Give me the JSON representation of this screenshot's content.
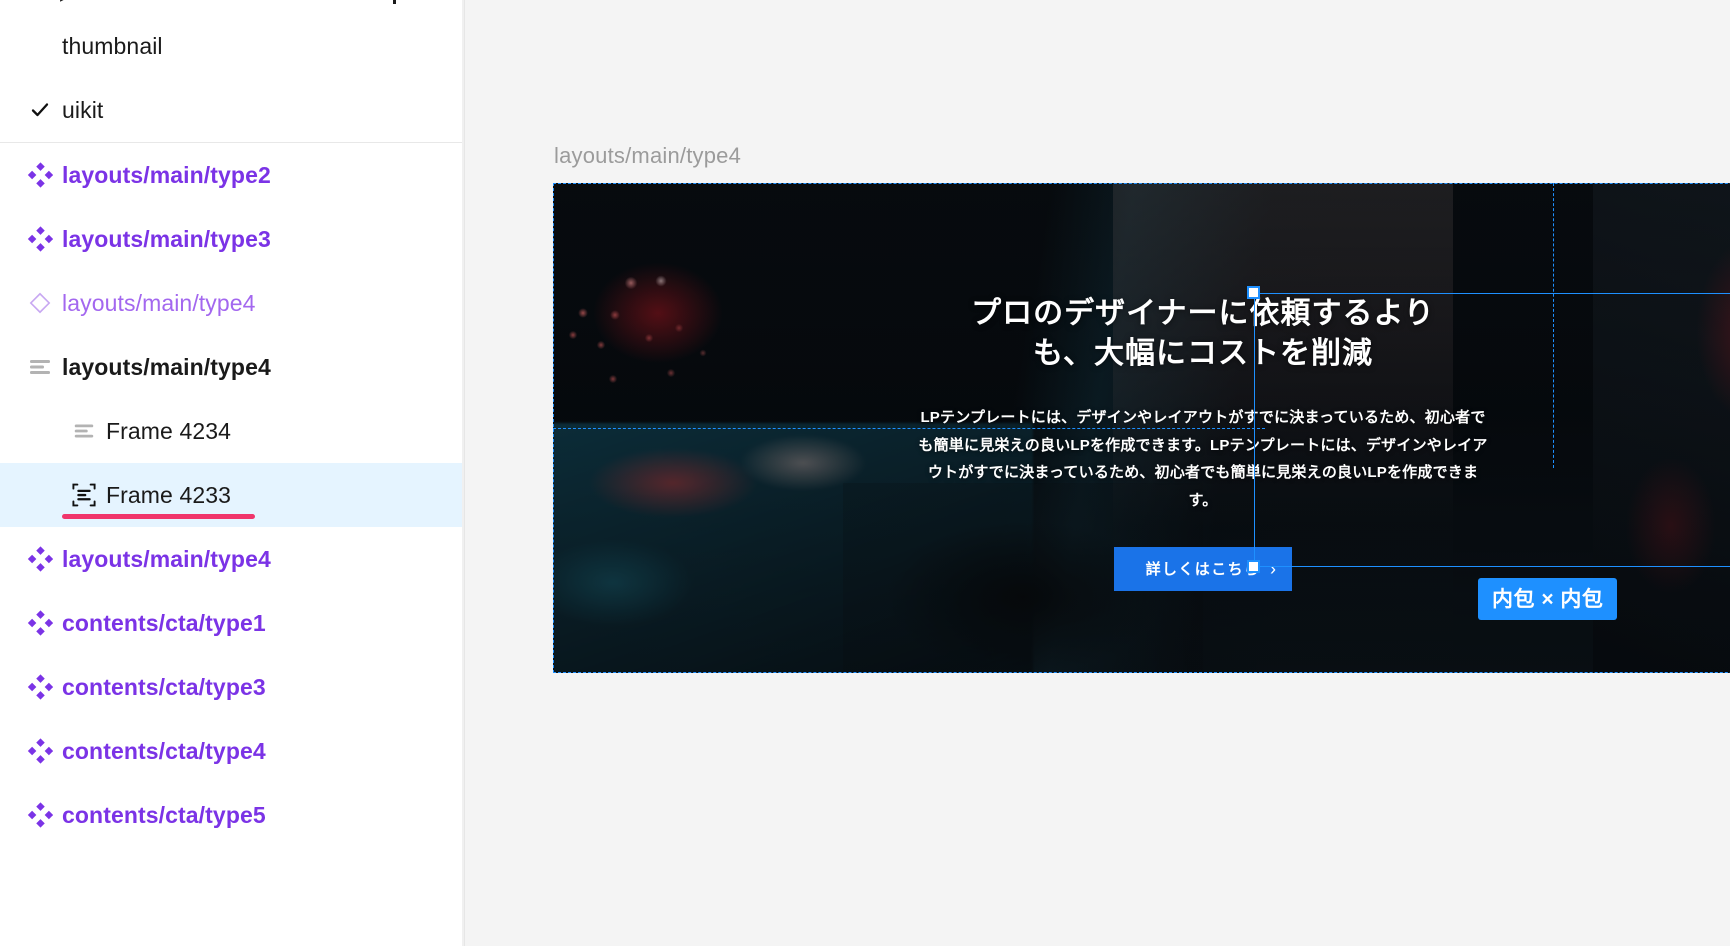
{
  "sidebar": {
    "top_cut_row": {
      "truncated": true
    },
    "pages": [
      {
        "label": "thumbnail",
        "icon": "none",
        "checked": false,
        "style": "plain",
        "indent": 0
      },
      {
        "label": "uikit",
        "icon": "check-icon",
        "checked": true,
        "style": "plain",
        "indent": 0
      }
    ],
    "layers": [
      {
        "label": "layouts/main/type2",
        "icon": "component-icon",
        "style": "purple",
        "indent": 0,
        "selected": false
      },
      {
        "label": "layouts/main/type3",
        "icon": "component-icon",
        "style": "purple",
        "indent": 0,
        "selected": false
      },
      {
        "label": "layouts/main/type4",
        "icon": "instance-icon",
        "style": "purple-light",
        "indent": 0,
        "selected": false
      },
      {
        "label": "layouts/main/type4",
        "icon": "autolayout-icon",
        "style": "bold",
        "indent": 0,
        "selected": false
      },
      {
        "label": "Frame 4234",
        "icon": "autolayout-icon",
        "style": "plain",
        "indent": 1,
        "selected": false
      },
      {
        "label": "Frame 4233",
        "icon": "hug-frame-icon",
        "style": "plain",
        "indent": 1,
        "selected": true,
        "annotated": true
      },
      {
        "label": "layouts/main/type4",
        "icon": "component-icon",
        "style": "purple",
        "indent": 0,
        "selected": false
      },
      {
        "label": "contents/cta/type1",
        "icon": "component-icon",
        "style": "purple",
        "indent": 0,
        "selected": false
      },
      {
        "label": "contents/cta/type3",
        "icon": "component-icon",
        "style": "purple",
        "indent": 0,
        "selected": false
      },
      {
        "label": "contents/cta/type4",
        "icon": "component-icon",
        "style": "purple",
        "indent": 0,
        "selected": false
      },
      {
        "label": "contents/cta/type5",
        "icon": "component-icon",
        "style": "purple",
        "indent": 0,
        "selected": false
      }
    ]
  },
  "canvas": {
    "frame_label": "layouts/main/type4",
    "hero": {
      "title": "プロのデザイナーに依頼するより\nも、大幅にコストを削減",
      "body": "LPテンプレートには、デザインやレイアウトがすでに決まっているため、初心者でも簡単に見栄えの良いLPを作成できます。LPテンプレートには、デザインやレイアウトがすでに決まっているため、初心者でも簡単に見栄えの良いLPを作成できます。",
      "cta_label": "詳しくはこちら",
      "cta_arrow": "›"
    },
    "selection": {
      "size_badge": "内包 × 内包"
    }
  },
  "colors": {
    "accent_blue": "#1e90ff",
    "cta_blue": "#1a73e8",
    "component_purple": "#7b33e6",
    "instance_purple": "#a367ef",
    "annotation_red": "#f0356b",
    "selected_row_bg": "#e5f4ff",
    "canvas_bg": "#f4f4f4"
  }
}
